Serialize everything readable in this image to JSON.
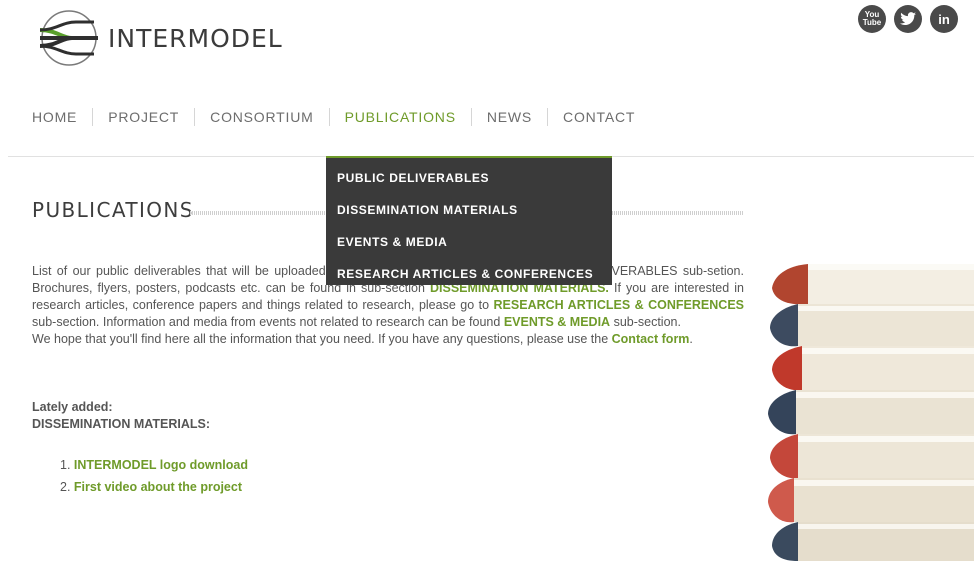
{
  "header": {
    "brand": "INTERMODEL",
    "social": [
      {
        "icon": "youtube-icon",
        "label": "You Tube"
      },
      {
        "icon": "twitter-icon",
        "label": ""
      },
      {
        "icon": "linkedin-icon",
        "label": "in"
      }
    ]
  },
  "nav": {
    "items": [
      "HOME",
      "PROJECT",
      "CONSORTIUM",
      "PUBLICATIONS",
      "NEWS",
      "CONTACT"
    ],
    "active": "PUBLICATIONS",
    "dropdown": [
      "PUBLIC DELIVERABLES",
      "DISSEMINATION MATERIALS",
      "EVENTS & MEDIA",
      "RESEARCH ARTICLES & CONFERENCES"
    ]
  },
  "page": {
    "title": "PUBLICATIONS",
    "intro_1": "List of our public deliverables that will be uploaded during the project can be found in PUBLIC DELIVERABLES sub-setion. Brochures, flyers, posters, podcasts etc. can be found in sub-section",
    "intro_link_1": "DISSEMINATION MATERIALS.",
    "intro_2": "If you are interested in research articles, conference papers and things related to research, please go to",
    "intro_link_2": "RESEARCH ARTICLES & CONFERENCES",
    "intro_3": "sub-section. Information and media from events not related to research can be found",
    "intro_link_3": "EVENTS & MEDIA",
    "intro_4": "sub-section.",
    "hope_text": "We hope that you'll find here all the information that you need. If you have any questions, please use the",
    "contact_link": "Contact form",
    "lately_label": "Lately added:",
    "lately_section": "DISSEMINATION MATERIALS:",
    "list": [
      {
        "num": "1.",
        "text": "INTERMODEL logo download"
      },
      {
        "num": "2.",
        "text": "First video about the project"
      }
    ]
  },
  "colors": {
    "accent": "#6f9b2a",
    "dropdown_bg": "#3a3a3a"
  }
}
